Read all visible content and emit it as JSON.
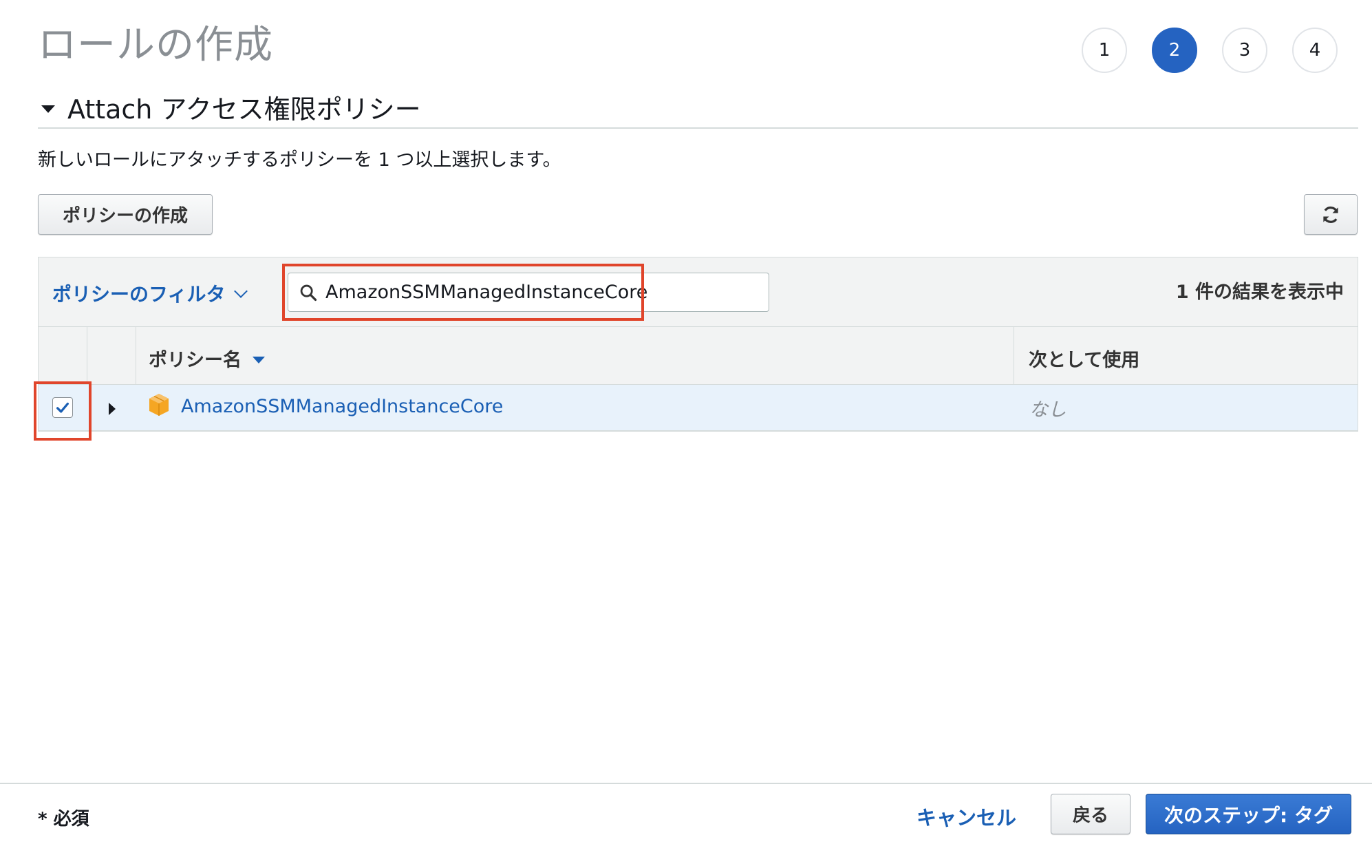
{
  "header": {
    "title": "ロールの作成",
    "steps": [
      "1",
      "2",
      "3",
      "4"
    ],
    "active_step": "2"
  },
  "section": {
    "title": "Attach アクセス権限ポリシー",
    "description": "新しいロールにアタッチするポリシーを 1 つ以上選択します。"
  },
  "toolbar": {
    "create_policy_label": "ポリシーの作成",
    "refresh_icon": "refresh-icon"
  },
  "filter": {
    "dropdown_label": "ポリシーのフィルタ",
    "search_value": "AmazonSSMManagedInstanceCore",
    "result_count": "1 件の結果を表示中"
  },
  "table": {
    "columns": [
      "ポリシー名",
      "次として使用"
    ],
    "sort_column": "ポリシー名",
    "rows": [
      {
        "checked": true,
        "name": "AmazonSSMManagedInstanceCore",
        "used_as": "なし",
        "icon": "aws-managed-policy-icon"
      }
    ]
  },
  "footer": {
    "required_note": "* 必須",
    "cancel_label": "キャンセル",
    "back_label": "戻る",
    "next_label": "次のステップ: タグ"
  },
  "colors": {
    "accent": "#2563c1",
    "link": "#1a5fb4",
    "highlight": "#e0452b",
    "selected_row": "#e8f2fb",
    "policy_icon": "#f5a623"
  }
}
